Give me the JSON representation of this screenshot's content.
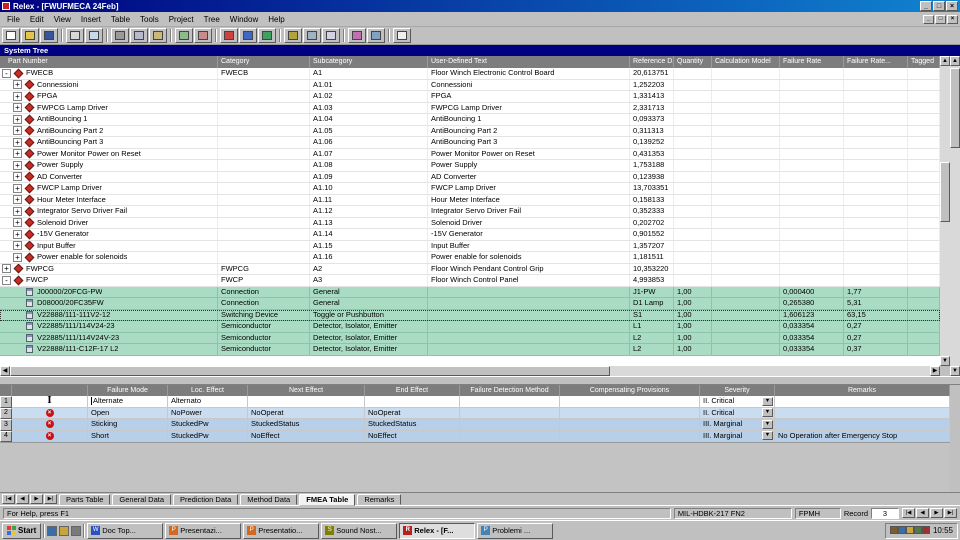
{
  "window": {
    "title": "Relex - [FWUFMECA 24Feb]"
  },
  "icons": {
    "minimize": "_",
    "restore": "□",
    "close": "×",
    "dropdown": "▼",
    "up": "▲",
    "down": "▼",
    "left": "◀",
    "right": "▶",
    "error_glyph": "×",
    "cursor_glyph": "I",
    "vcr": [
      "|◀",
      "◀",
      "▶",
      "▶|"
    ]
  },
  "menu": {
    "items": [
      "File",
      "Edit",
      "View",
      "Insert",
      "Table",
      "Tools",
      "Project",
      "Tree",
      "Window",
      "Help"
    ]
  },
  "toolbar": {
    "groups": [
      [
        {
          "name": "new-file",
          "color": "#ffffff"
        },
        {
          "name": "open-folder",
          "color": "#e3c44d"
        },
        {
          "name": "save-file",
          "color": "#39539c"
        }
      ],
      [
        {
          "name": "print",
          "color": "#d8d8d8"
        },
        {
          "name": "print-preview",
          "color": "#c9d9ea"
        }
      ],
      [
        {
          "name": "cut",
          "color": "#9a9a9a"
        },
        {
          "name": "copy",
          "color": "#b9b9cd"
        },
        {
          "name": "paste",
          "color": "#c9b878"
        }
      ],
      [
        {
          "name": "insert-record",
          "color": "#8cbb8c"
        },
        {
          "name": "delete-record",
          "color": "#c98c8c"
        }
      ],
      [
        {
          "name": "calculate",
          "color": "#cf4040"
        },
        {
          "name": "fault-tree",
          "color": "#4068c0"
        },
        {
          "name": "bar-chart",
          "color": "#3fa05f"
        }
      ],
      [
        {
          "name": "filter",
          "color": "#b3a340"
        },
        {
          "name": "zoom",
          "color": "#a0b2c4"
        },
        {
          "name": "report",
          "color": "#d2d2e4"
        }
      ],
      [
        {
          "name": "pie-chart",
          "color": "#c06fb0"
        },
        {
          "name": "library",
          "color": "#7fa3c0"
        }
      ],
      [
        {
          "name": "help",
          "color": "#efefef"
        }
      ]
    ]
  },
  "system_tree": {
    "caption": "System Tree"
  },
  "grid": {
    "columns": [
      "Part Number",
      "Category",
      "Subcategory",
      "User-Defined Text",
      "Reference D...",
      "Quantity",
      "Calculation Model",
      "Failure Rate",
      "Failure Rate...",
      "Tagged"
    ],
    "rows": [
      {
        "level": 0,
        "exp": "-",
        "part": "FWECB",
        "category": "FWECB",
        "subcategory": "A1",
        "text": "Floor Winch Electronic Control Board",
        "ref": "20,613751"
      },
      {
        "level": 1,
        "exp": "+",
        "part": "Connessioni",
        "subcategory": "A1.01",
        "text": "Connessioni",
        "ref": "1,252203"
      },
      {
        "level": 1,
        "exp": "+",
        "part": "FPGA",
        "subcategory": "A1.02",
        "text": "FPGA",
        "ref": "1,331413"
      },
      {
        "level": 1,
        "exp": "+",
        "part": "FWPCG Lamp Driver",
        "subcategory": "A1.03",
        "text": "FWPCG Lamp Driver",
        "ref": "2,331713"
      },
      {
        "level": 1,
        "exp": "+",
        "part": "AntiBouncing 1",
        "subcategory": "A1.04",
        "text": "AntiBouncing 1",
        "ref": "0,093373"
      },
      {
        "level": 1,
        "exp": "+",
        "part": "AntiBouncing Part 2",
        "subcategory": "A1.05",
        "text": "AntiBouncing Part 2",
        "ref": "0,311313"
      },
      {
        "level": 1,
        "exp": "+",
        "part": "AntiBouncing Part 3",
        "subcategory": "A1.06",
        "text": "AntiBouncing Part 3",
        "ref": "0,139252"
      },
      {
        "level": 1,
        "exp": "+",
        "part": "Power Monitor Power on Reset",
        "subcategory": "A1.07",
        "text": "Power Monitor Power on Reset",
        "ref": "0,431353"
      },
      {
        "level": 1,
        "exp": "+",
        "part": "Power Supply",
        "subcategory": "A1.08",
        "text": "Power Supply",
        "ref": "1,753188"
      },
      {
        "level": 1,
        "exp": "+",
        "part": "AD Converter",
        "subcategory": "A1.09",
        "text": "AD Converter",
        "ref": "0,123938"
      },
      {
        "level": 1,
        "exp": "+",
        "part": "FWCP Lamp Driver",
        "subcategory": "A1.10",
        "text": "FWCP Lamp Driver",
        "ref": "13,703351"
      },
      {
        "level": 1,
        "exp": "+",
        "part": "Hour Meter Interface",
        "subcategory": "A1.11",
        "text": "Hour Meter Interface",
        "ref": "0,158133"
      },
      {
        "level": 1,
        "exp": "+",
        "part": "Integrator Servo Driver Fail",
        "subcategory": "A1.12",
        "text": "Integrator Servo Driver Fail",
        "ref": "0,352333"
      },
      {
        "level": 1,
        "exp": "+",
        "part": "Solenoid Driver",
        "subcategory": "A1.13",
        "text": "Solenoid Driver",
        "ref": "0,202702"
      },
      {
        "level": 1,
        "exp": "+",
        "part": "-15V Generator",
        "subcategory": "A1.14",
        "text": "-15V Generator",
        "ref": "0,901552"
      },
      {
        "level": 1,
        "exp": "+",
        "part": "Input Buffer",
        "subcategory": "A1.15",
        "text": "Input Buffer",
        "ref": "1,357207"
      },
      {
        "level": 1,
        "exp": "+",
        "part": "Power enable for solenoids",
        "subcategory": "A1.16",
        "text": "Power enable for solenoids",
        "ref": "1,181511"
      },
      {
        "level": 0,
        "exp": "+",
        "part": "FWPCG",
        "category": "FWPCG",
        "subcategory": "A2",
        "text": "Floor Winch Pendant Control Grip",
        "ref": "10,353220"
      },
      {
        "level": 0,
        "exp": "-",
        "part": "FWCP",
        "category": "FWCP",
        "subcategory": "A3",
        "text": "Floor Winch Control Panel",
        "ref": "4,993853"
      },
      {
        "level": 1,
        "green": true,
        "part": "J00000/20FCG-PW",
        "category": "Connection",
        "subcategory": "General",
        "ref": "J1-PW",
        "qty": "1,00",
        "fr": "0,000400",
        "frp": "1,77"
      },
      {
        "level": 1,
        "green": true,
        "part": "D08000/20FC35FW",
        "category": "Connection",
        "subcategory": "General",
        "ref": "D1 Lamp",
        "qty": "1,00",
        "fr": "0,265380",
        "frp": "5,31"
      },
      {
        "level": 1,
        "green": true,
        "selected": true,
        "part": "V22888/111-111V2-12",
        "category": "Switching Device",
        "subcategory": "Toggle or Pushbutton",
        "ref": "S1",
        "qty": "1,00",
        "fr": "1,606123",
        "frp": "63,15"
      },
      {
        "level": 1,
        "green": true,
        "part": "V22885/111/114V24-23",
        "category": "Semiconductor",
        "subcategory": "Detector, Isolator, Emitter",
        "ref": "L1",
        "qty": "1,00",
        "fr": "0,033354",
        "frp": "0,27"
      },
      {
        "level": 1,
        "green": true,
        "part": "V22885/111/114V24V-23",
        "category": "Semiconductor",
        "subcategory": "Detector, Isolator, Emitter",
        "ref": "L2",
        "qty": "1,00",
        "fr": "0,033354",
        "frp": "0,27"
      },
      {
        "level": 1,
        "green": true,
        "part": "V22888/111-C12F-17 L2",
        "category": "Semiconductor",
        "subcategory": "Detector, Isolator, Emitter",
        "ref": "L2",
        "qty": "1,00",
        "fr": "0,033354",
        "frp": "0,37"
      }
    ]
  },
  "fmea": {
    "columns": [
      "Failure Mode",
      "Loc. Effect",
      "Next Effect",
      "End Effect",
      "Failure Detection Method",
      "Compensating Provisions",
      "Severity",
      "Remarks"
    ],
    "rows": [
      {
        "num": "1",
        "icon": "cursor",
        "failure_mode": "Alternate",
        "loc_effect": "Alternato",
        "next_effect": "",
        "end_effect": "",
        "detection": "",
        "compensating": "",
        "severity": "II. Critical",
        "remarks": "",
        "tone": "white"
      },
      {
        "num": "2",
        "icon": "error",
        "failure_mode": "Open",
        "loc_effect": "NoPower",
        "next_effect": "NoOperat",
        "end_effect": "NoOperat",
        "detection": "",
        "compensating": "",
        "severity": "II. Critical",
        "remarks": "",
        "tone": "blue"
      },
      {
        "num": "3",
        "icon": "error",
        "failure_mode": "Sticking",
        "loc_effect": "StuckedPw",
        "next_effect": "StuckedStatus",
        "end_effect": "StuckedStatus",
        "detection": "",
        "compensating": "",
        "severity": "III. Marginal",
        "remarks": "",
        "tone": "blue"
      },
      {
        "num": "4",
        "icon": "error",
        "failure_mode": "Short",
        "loc_effect": "StuckedPw",
        "next_effect": "NoEffect",
        "end_effect": "NoEffect",
        "detection": "",
        "compensating": "",
        "severity": "III. Marginal",
        "remarks": "No Operation after Emergency Stop",
        "tone": "blue"
      }
    ]
  },
  "tabs": {
    "items": [
      {
        "label": "Parts Table"
      },
      {
        "label": "General Data"
      },
      {
        "label": "Prediction Data"
      },
      {
        "label": "Method Data"
      },
      {
        "label": "FMEA Table",
        "active": true
      },
      {
        "label": "Remarks"
      }
    ]
  },
  "statusbar": {
    "help": "For Help, press F1",
    "model": "MIL-HDBK-217 FN2",
    "units": "FPMH",
    "record_label": "Record",
    "record_value": "3"
  },
  "taskbar": {
    "start_label": "Start",
    "logo_colors": [
      "#e53b2c",
      "#3ba33b",
      "#3b6ee5",
      "#e5c53b"
    ],
    "quick_launch": [
      {
        "name": "internet-explorer",
        "color": "#3a6ea5"
      },
      {
        "name": "outlook",
        "color": "#c8a43c"
      },
      {
        "name": "show-desktop",
        "color": "#7a7a7a"
      }
    ],
    "buttons": [
      {
        "label": "Doc Top...",
        "letter": "W",
        "color": "#2a52be"
      },
      {
        "label": "Presentazi...",
        "letter": "P",
        "color": "#d2691e"
      },
      {
        "label": "Presentatio...",
        "letter": "P",
        "color": "#d2691e"
      },
      {
        "label": "Sound Nost...",
        "letter": "S",
        "color": "#808000"
      },
      {
        "label": "Relex - [F...",
        "letter": "R",
        "color": "#b22222",
        "active": true
      },
      {
        "label": "Problemi ...",
        "letter": "P",
        "color": "#4682b4"
      }
    ],
    "tray_icons": [
      {
        "name": "task-scheduler",
        "color": "#7a5c2e"
      },
      {
        "name": "display-settings",
        "color": "#3b6ea5"
      },
      {
        "name": "volume",
        "color": "#caa53c"
      },
      {
        "name": "network",
        "color": "#4e7a4e"
      },
      {
        "name": "antivirus",
        "color": "#a03030"
      }
    ],
    "clock": "10:55"
  }
}
